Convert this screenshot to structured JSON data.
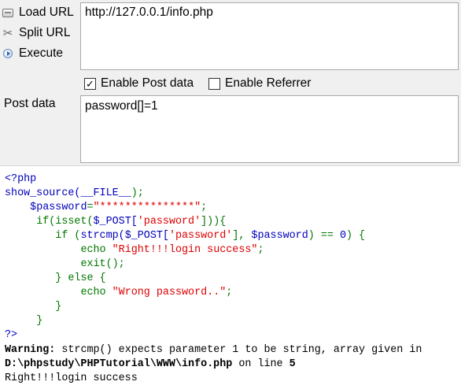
{
  "toolbar": {
    "load_url": "Load URL",
    "split_url": "Split URL",
    "execute": "Execute"
  },
  "url_value": "http://127.0.0.1/info.php",
  "options": {
    "enable_post": "Enable Post data",
    "enable_post_checked": true,
    "enable_referrer": "Enable Referrer",
    "enable_referrer_checked": false
  },
  "post": {
    "label": "Post data",
    "value": "password[]=1"
  },
  "source": {
    "open_tag": "<?php",
    "l1_fn": "show_source(",
    "l1_const": "__FILE__",
    "l1_end": ");",
    "l2_var": "$password",
    "l2_eq": "=",
    "l2_str": "\"***************\"",
    "l2_end": ";",
    "l3_if": "if(isset(",
    "l3_var": "$_POST[",
    "l3_str": "'password'",
    "l3_end": "])){",
    "l4_if": "if (",
    "l4_fn": "strcmp(",
    "l4_var": "$_POST[",
    "l4_str": "'password'",
    "l4_mid": "], ",
    "l4_var2": "$password",
    "l4_close": ") == ",
    "l4_num": "0",
    "l4_end": ") {",
    "l5_echo": "echo ",
    "l5_str": "\"Right!!!login success\"",
    "l5_end": ";",
    "l6_exit": "exit();",
    "l7_else": "} else {",
    "l8_echo": "echo ",
    "l8_str": "\"Wrong password..\"",
    "l8_end": ";",
    "l9_close": "}",
    "l10_close": "}",
    "close_tag": "?>"
  },
  "output": {
    "warning_label": "Warning",
    "warning_colon": ":",
    "warning_text": " strcmp() expects parameter 1 to be string, array given in",
    "file_path": "D:\\phpstudy\\PHPTutorial\\WWW\\info.php",
    "on_line": " on line ",
    "line_no": "5",
    "result": "Right!!!login success"
  }
}
